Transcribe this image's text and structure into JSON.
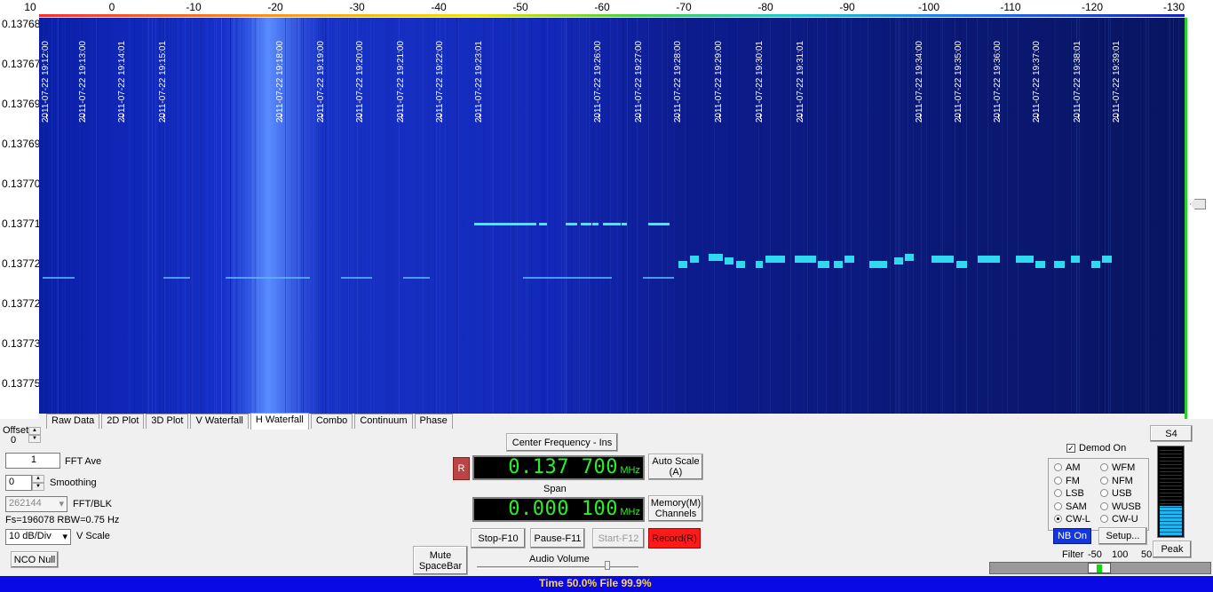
{
  "top_scale": {
    "ticks": [
      "10",
      "0",
      "-10",
      "-20",
      "-30",
      "-40",
      "-50",
      "-60",
      "-70",
      "-80",
      "-90",
      "-100",
      "-110",
      "-120",
      "-130"
    ]
  },
  "y_axis": {
    "labels": [
      "0.13768",
      "0.13767",
      "0.13769",
      "0.13769",
      "0.13770",
      "0.13771",
      "0.13772",
      "0.13772",
      "0.13773",
      "0.13775"
    ]
  },
  "timestamps": [
    "2011-07-22 19:12:00",
    "2011-07-22 19:13:00",
    "2011-07-22 19:14:01",
    "2011-07-22 19:15:01",
    "2011-07-22 19:18:00",
    "2011-07-22 19:19:00",
    "2011-07-22 19:20:00",
    "2011-07-22 19:21:00",
    "2011-07-22 19:22:00",
    "2011-07-22 19:23:01",
    "2011-07-22 19:26:00",
    "2011-07-22 19:27:00",
    "2011-07-22 19:28:00",
    "2011-07-22 19:29:00",
    "2011-07-22 19:30:01",
    "2011-07-22 19:31:01",
    "2011-07-22 19:34:00",
    "2011-07-22 19:35:00",
    "2011-07-22 19:36:00",
    "2011-07-22 19:37:00",
    "2011-07-22 19:38:01",
    "2011-07-22 19:39:01"
  ],
  "tabs": [
    "Raw Data",
    "2D Plot",
    "3D Plot",
    "V Waterfall",
    "H Waterfall",
    "Combo",
    "Continuum",
    "Phase"
  ],
  "active_tab": "H Waterfall",
  "left_panel": {
    "offset_label": "Offset",
    "offset_value": "0",
    "fft_ave_value": "1",
    "fft_ave_label": "FFT Ave",
    "smoothing_value": "0",
    "smoothing_label": "Smoothing",
    "fft_blk_value": "262144",
    "fft_blk_label": "FFT/BLK",
    "fs_info": "Fs=196078 RBW=0.75 Hz",
    "vscale_value": "10 dB/Div",
    "vscale_label": "V Scale",
    "nco_null": "NCO Null"
  },
  "center": {
    "center_freq_button": "Center Frequency - Ins",
    "r_button": "R",
    "freq_value": "0.137 700",
    "freq_unit": "MHz",
    "auto_scale": "Auto Scale (A)",
    "span_label": "Span",
    "span_value": "0.000 100",
    "span_unit": "MHz",
    "memory": "Memory(M) Channels",
    "stop": "Stop-F10",
    "pause": "Pause-F11",
    "start": "Start-F12",
    "record": "Record(R)",
    "mute": "Mute SpaceBar",
    "audio_volume": "Audio Volume"
  },
  "demod": {
    "demod_on_label": "Demod On",
    "modes_left": [
      "AM",
      "FM",
      "LSB",
      "SAM",
      "CW-L"
    ],
    "modes_right": [
      "WFM",
      "NFM",
      "USB",
      "WUSB",
      "CW-U"
    ],
    "selected": "CW-L",
    "nb_on": "NB On",
    "setup": "Setup..."
  },
  "smeter": {
    "label": "S4",
    "peak": "Peak"
  },
  "filter": {
    "label": "Filter",
    "values": [
      "-50",
      "100",
      "50"
    ]
  },
  "status": {
    "text": "Time 50.0%   File 99.9%"
  },
  "colors": {
    "status_bar": "#0909e6",
    "lcd_text": "#29f029",
    "record_button": "#ff1a1a",
    "nb_on": "#1237e0"
  }
}
